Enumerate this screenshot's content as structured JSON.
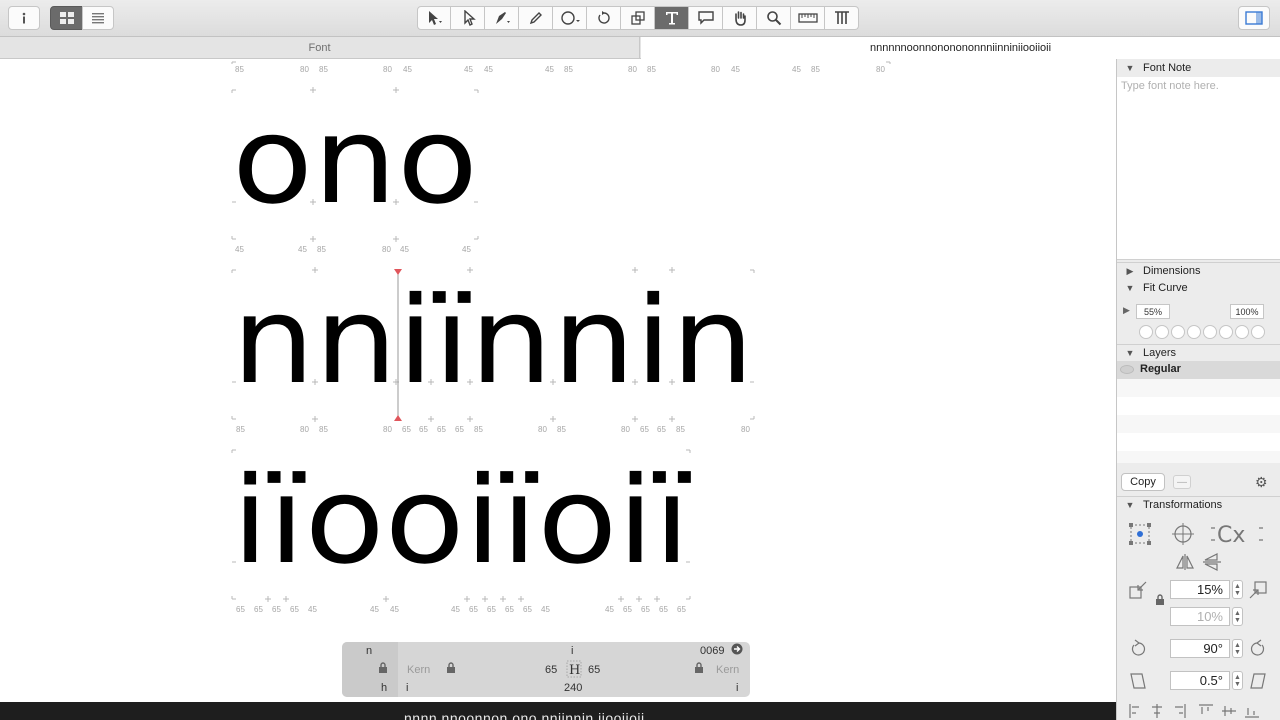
{
  "toolbar": {
    "left_buttons": [
      {
        "name": "info-button",
        "icon": "info-icon"
      },
      {
        "name": "grid-view-button",
        "icon": "grid-icon",
        "active": true
      },
      {
        "name": "list-view-button",
        "icon": "list-icon"
      }
    ],
    "tools": [
      {
        "name": "select-tool",
        "icon": "arrow-pointer-icon"
      },
      {
        "name": "select-all-layers-tool",
        "icon": "pointer-plus-icon"
      },
      {
        "name": "pen-tool",
        "icon": "pen-nib-icon"
      },
      {
        "name": "pencil-tool",
        "icon": "pencil-icon"
      },
      {
        "name": "primitives-tool",
        "icon": "ellipse-icon"
      },
      {
        "name": "rotate-tool",
        "icon": "rotate-icon"
      },
      {
        "name": "scale-tool",
        "icon": "scale-icon"
      },
      {
        "name": "text-tool",
        "icon": "text-t-icon",
        "active": true
      },
      {
        "name": "annotation-tool",
        "icon": "speech-bubble-icon"
      },
      {
        "name": "hand-tool",
        "icon": "hand-icon"
      },
      {
        "name": "zoom-tool",
        "icon": "magnifier-icon"
      },
      {
        "name": "measurement-tool",
        "icon": "ruler-icon"
      },
      {
        "name": "glyph-info-tool",
        "icon": "type-columns-icon"
      }
    ],
    "right_button": {
      "name": "sidebar-toggle-button",
      "icon": "sidebar-icon"
    }
  },
  "tabs": {
    "font_tab": "Font",
    "text_tab": "nnnnnnoonnononononnniinniniiooiioii"
  },
  "canvas": {
    "line1": {
      "glyphs": [
        "o",
        "n",
        "o"
      ],
      "top_numbers": [
        "85",
        "80",
        "85",
        "80",
        "45",
        "45",
        "45",
        "45",
        "85",
        "80",
        "85",
        "80",
        "45",
        "45",
        "85",
        "80"
      ],
      "bottom_numbers": [
        "45",
        "45",
        "85",
        "80",
        "45",
        "45"
      ]
    },
    "line2": {
      "glyphs": [
        "n",
        "n",
        "i",
        "ï",
        "n",
        "n",
        "i",
        "n"
      ],
      "bottom_numbers": [
        "85",
        "80",
        "85",
        "80",
        "65",
        "65",
        "65",
        "65",
        "85",
        "80",
        "85",
        "80",
        "65",
        "65",
        "85",
        "80"
      ]
    },
    "line3": {
      "glyphs": [
        "i",
        "ï",
        "o",
        "o",
        "i",
        "ï",
        "o",
        "i",
        "ï"
      ],
      "bottom_numbers": [
        "65",
        "65",
        "65",
        "65",
        "45",
        "45",
        "45",
        "45",
        "65",
        "65",
        "65",
        "65",
        "45",
        "45",
        "65",
        "65",
        "65",
        "65"
      ]
    }
  },
  "kern_panel": {
    "left_glyph": "n",
    "center_glyph": "i",
    "unicode": "0069",
    "left_kern_label": "Kern",
    "right_kern_label": "Kern",
    "left_sidebearing": "65",
    "right_sidebearing": "65",
    "width": "240",
    "bottom_left": "h",
    "bottom_mid_left": "i",
    "bottom_right": "i"
  },
  "statusbar": {
    "preview_text": "nnnn nnoonnon ono nniinnin iiooiioii"
  },
  "sidebar": {
    "font_note": {
      "title": "Font Note",
      "placeholder": "Type font note here."
    },
    "dimensions": {
      "title": "Dimensions"
    },
    "fit_curve": {
      "title": "Fit Curve",
      "min": "55%",
      "max": "100%"
    },
    "layers": {
      "title": "Layers",
      "items": [
        "Regular"
      ]
    },
    "copy_button": "Copy",
    "minus_button": "—",
    "transformations": {
      "title": "Transformations",
      "scale_value": "15%",
      "scale_value_2": "10%",
      "rotate_value": "90°",
      "slant_value": "0.5°"
    }
  }
}
